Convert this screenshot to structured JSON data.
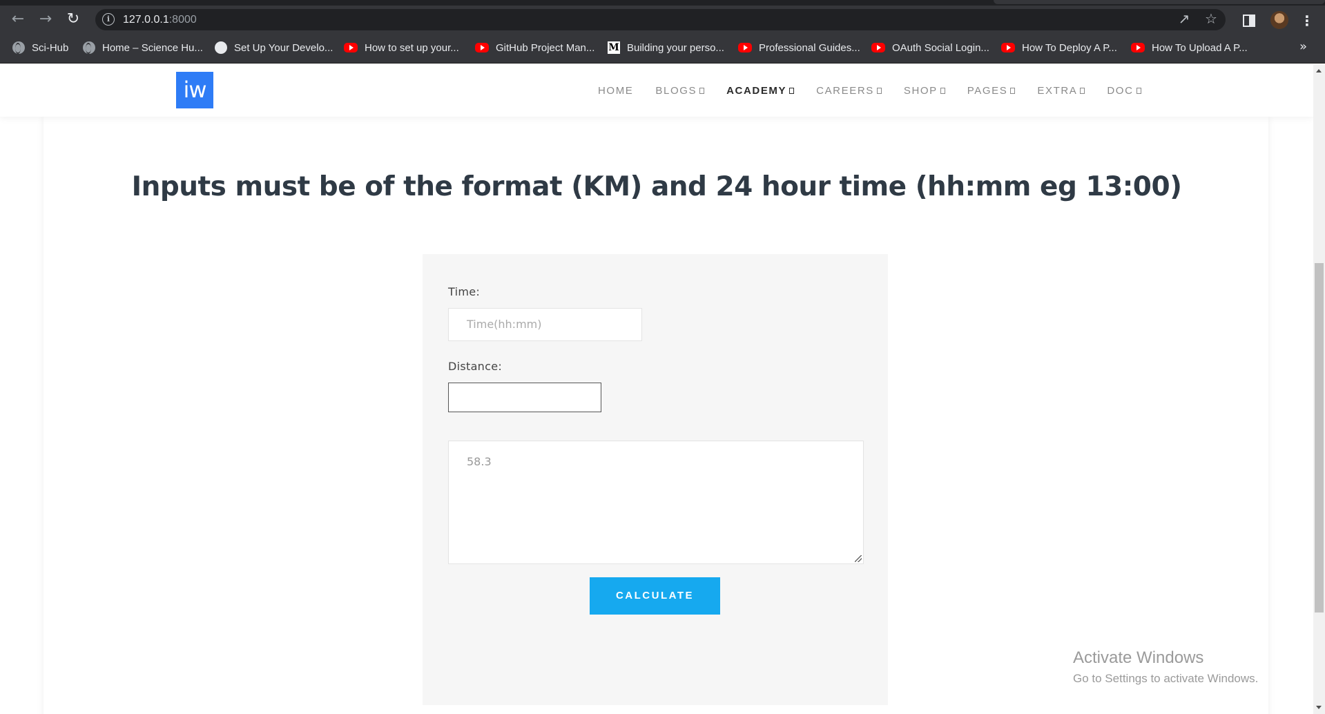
{
  "browser": {
    "url_host": "127.0.0.1",
    "url_port": ":8000",
    "icons": {
      "back": "arrow-left-icon",
      "forward": "arrow-right-icon",
      "reload": "reload-icon",
      "share": "share-icon",
      "bookmark": "star-icon",
      "side_panel": "side-panel-icon",
      "menu": "kebab-menu-icon"
    },
    "bookmarks": [
      {
        "label": "Sci-Hub",
        "icon": "globe"
      },
      {
        "label": "Home – Science Hu...",
        "icon": "globe"
      },
      {
        "label": "Set Up Your Develo...",
        "icon": "puzzle"
      },
      {
        "label": "How to set up your...",
        "icon": "youtube"
      },
      {
        "label": "GitHub Project Man...",
        "icon": "youtube"
      },
      {
        "label": "Building your perso...",
        "icon": "medium"
      },
      {
        "label": "Professional Guides...",
        "icon": "youtube"
      },
      {
        "label": "OAuth Social Login...",
        "icon": "youtube"
      },
      {
        "label": "How To Deploy A P...",
        "icon": "youtube"
      },
      {
        "label": "How To Upload A P...",
        "icon": "youtube"
      }
    ],
    "bookmarks_overflow": "»"
  },
  "site": {
    "logo_text": "iw",
    "logo_color": "#2e7cf6",
    "menu": [
      {
        "label": "HOME",
        "dropdown": false
      },
      {
        "label": "BLOGS",
        "dropdown": true
      },
      {
        "label": "ACADEMY",
        "dropdown": true,
        "active": true
      },
      {
        "label": "CAREERS",
        "dropdown": true
      },
      {
        "label": "SHOP",
        "dropdown": true
      },
      {
        "label": "PAGES",
        "dropdown": true
      },
      {
        "label": "EXTRA",
        "dropdown": true
      },
      {
        "label": "DOC",
        "dropdown": true
      }
    ]
  },
  "main": {
    "heading": "Inputs must be of the format (KM) and 24 hour time (hh:mm eg 13:00)",
    "form": {
      "time_label": "Time:",
      "time_placeholder": "Time(hh:mm)",
      "distance_label": "Distance:",
      "distance_value": "",
      "result_value": "58.3",
      "button_label": "CALCULATE",
      "button_color": "#16a9ef"
    }
  },
  "watermark": {
    "line1": "Activate Windows",
    "line2": "Go to Settings to activate Windows."
  }
}
